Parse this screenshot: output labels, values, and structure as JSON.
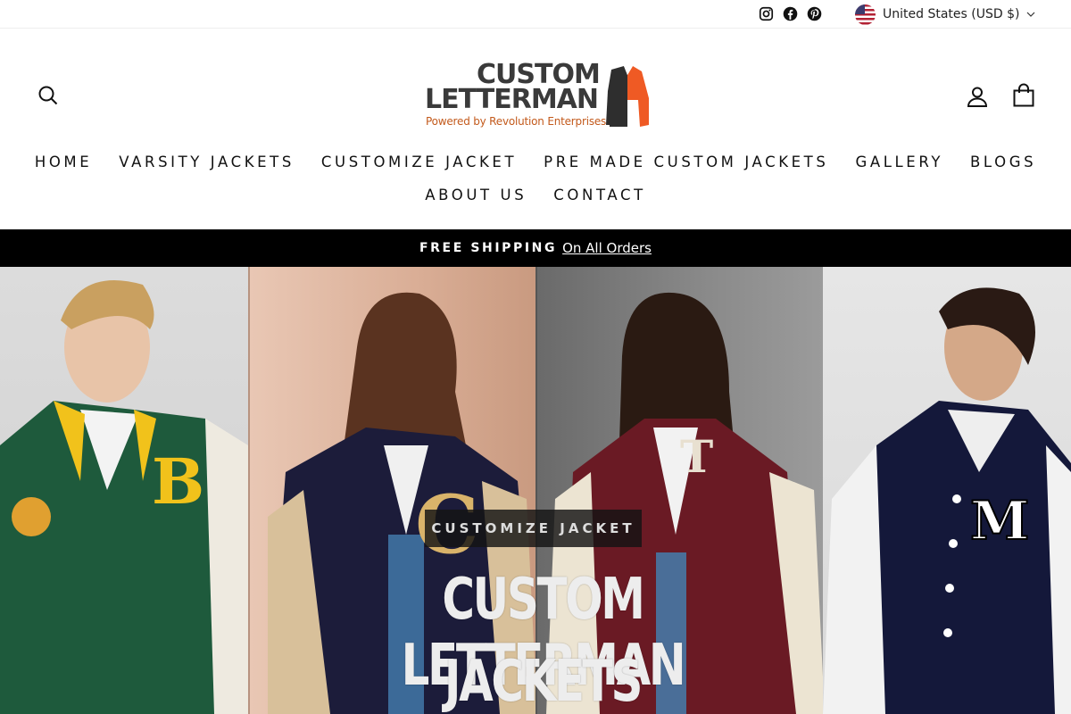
{
  "utility": {
    "social_icons": [
      "instagram-icon",
      "facebook-icon",
      "pinterest-icon"
    ],
    "currency_label": "United States (USD $)"
  },
  "header": {
    "logo": {
      "line1": "CUSTOM",
      "line2": "LETTERMAN",
      "tagline": "Powered by Revolution Enterprises"
    },
    "icons": [
      "search-icon",
      "account-icon",
      "cart-icon"
    ]
  },
  "nav": {
    "row1": [
      "HOME",
      "VARSITY JACKETS",
      "CUSTOMIZE JACKET",
      "PRE MADE CUSTOM JACKETS",
      "GALLERY",
      "BLOGS"
    ],
    "row2": [
      "ABOUT US",
      "CONTACT"
    ]
  },
  "announcement": {
    "strong": "FREE SHIPPING",
    "link": "On All Orders"
  },
  "hero": {
    "cta": "CUSTOMIZE JACKET",
    "title_line1": "CUSTOM LETTERMAN",
    "title_line2": "JACKETS"
  },
  "colors": {
    "brand_orange": "#ef5a24",
    "logo_gray": "#3a3a3a",
    "announce_bg": "#000000"
  }
}
